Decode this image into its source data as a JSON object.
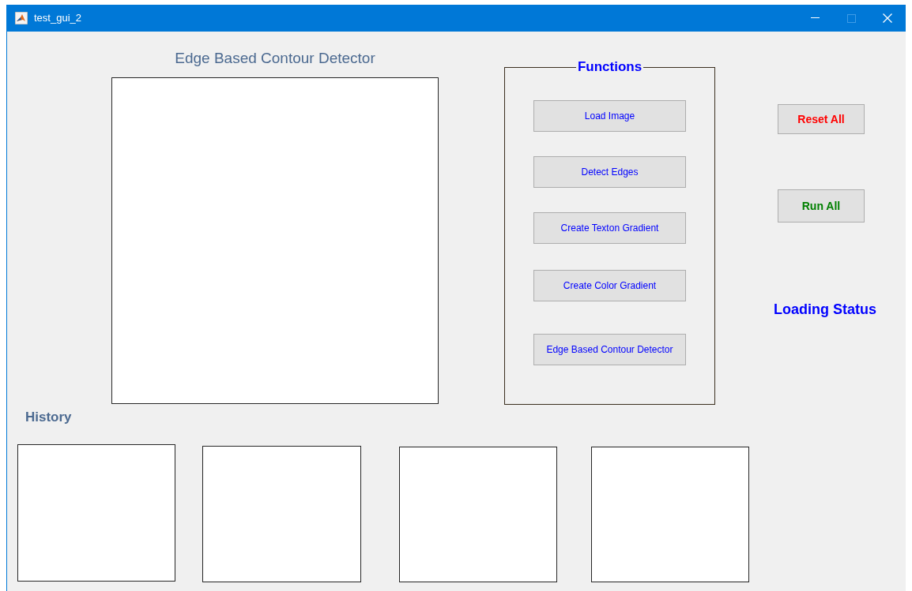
{
  "window": {
    "title": "test_gui_2",
    "maximize_disabled": true
  },
  "main_title": "Edge Based Contour Detector",
  "functions_panel": {
    "title": "Functions",
    "buttons": [
      "Load Image",
      "Detect Edges",
      "Create Texton Gradient",
      "Create Color Gradient",
      "Edge Based Contour Detector"
    ]
  },
  "side_buttons": [
    {
      "label": "Reset All",
      "color": "#ff0000"
    },
    {
      "label": "Run All",
      "color": "#008000"
    }
  ],
  "status_label": "Loading Status",
  "history_label": "History"
}
